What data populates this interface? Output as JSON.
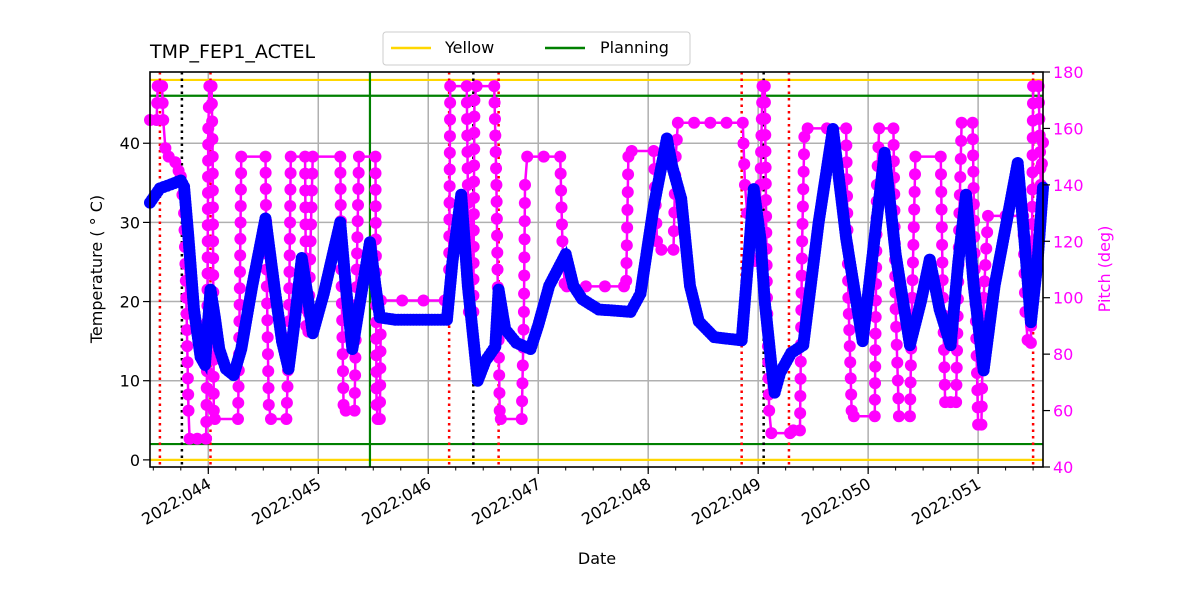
{
  "chart_data": {
    "type": "line",
    "title": "TMP_FEP1_ACTEL",
    "xlabel": "Date",
    "ylabel": "Temperature ($^\\circ$C)",
    "ylabel_display": "Temperature ( ° C)",
    "y2label": "Pitch (deg)",
    "grid": true,
    "legend": {
      "placement": "top-center",
      "entries": [
        "Yellow",
        "Planning"
      ]
    },
    "xlim": [
      43.47,
      51.59
    ],
    "ylim": [
      -0.9,
      49
    ],
    "y2lim": [
      40,
      180
    ],
    "x_ticks": [
      {
        "value": 44,
        "label": "2022:044"
      },
      {
        "value": 45,
        "label": "2022:045"
      },
      {
        "value": 46,
        "label": "2022:046"
      },
      {
        "value": 47,
        "label": "2022:047"
      },
      {
        "value": 48,
        "label": "2022:048"
      },
      {
        "value": 49,
        "label": "2022:049"
      },
      {
        "value": 50,
        "label": "2022:050"
      },
      {
        "value": 51,
        "label": "2022:051"
      }
    ],
    "x_minor_step": 0.25,
    "y_ticks": [
      0,
      10,
      20,
      30,
      40
    ],
    "y2_ticks": [
      40,
      60,
      80,
      100,
      120,
      140,
      160,
      180
    ],
    "limit_lines": [
      {
        "name": "Yellow",
        "values": [
          48,
          0
        ],
        "color": "#ffd700"
      },
      {
        "name": "Planning",
        "values": [
          46,
          2
        ],
        "color": "#008000"
      }
    ],
    "vlines": [
      {
        "x": 43.56,
        "color": "#ff0000",
        "style": "dotted"
      },
      {
        "x": 44.02,
        "color": "#ff0000",
        "style": "dotted"
      },
      {
        "x": 46.19,
        "color": "#ff0000",
        "style": "dotted"
      },
      {
        "x": 46.64,
        "color": "#ff0000",
        "style": "dotted"
      },
      {
        "x": 48.85,
        "color": "#ff0000",
        "style": "dotted"
      },
      {
        "x": 49.28,
        "color": "#ff0000",
        "style": "dotted"
      },
      {
        "x": 51.5,
        "color": "#ff0000",
        "style": "dotted"
      },
      {
        "x": 43.76,
        "color": "#000000",
        "style": "dotted"
      },
      {
        "x": 46.41,
        "color": "#000000",
        "style": "dotted"
      },
      {
        "x": 49.05,
        "color": "#000000",
        "style": "dotted"
      },
      {
        "x": 45.47,
        "color": "#008000",
        "style": "solid"
      }
    ],
    "series": [
      {
        "name": "TMP_FEP1_ACTEL",
        "axis": "left",
        "color": "#0000ff",
        "points": [
          [
            43.47,
            32.5
          ],
          [
            43.56,
            34.3
          ],
          [
            43.66,
            34.8
          ],
          [
            43.75,
            35.3
          ],
          [
            43.78,
            34.5
          ],
          [
            43.82,
            28
          ],
          [
            43.87,
            19
          ],
          [
            43.93,
            13
          ],
          [
            43.97,
            12
          ],
          [
            44.02,
            21.5
          ],
          [
            44.06,
            18
          ],
          [
            44.1,
            14
          ],
          [
            44.16,
            11.5
          ],
          [
            44.23,
            10.7
          ],
          [
            44.3,
            14
          ],
          [
            44.4,
            22
          ],
          [
            44.52,
            30.5
          ],
          [
            44.6,
            22
          ],
          [
            44.67,
            15
          ],
          [
            44.73,
            11.5
          ],
          [
            44.79,
            18
          ],
          [
            44.85,
            25.5
          ],
          [
            44.9,
            21
          ],
          [
            44.95,
            16
          ],
          [
            45.05,
            21
          ],
          [
            45.2,
            30
          ],
          [
            45.25,
            22
          ],
          [
            45.31,
            14
          ],
          [
            45.38,
            20
          ],
          [
            45.47,
            27.5
          ],
          [
            45.52,
            22
          ],
          [
            45.56,
            18
          ],
          [
            45.7,
            17.7
          ],
          [
            46.17,
            17.7
          ],
          [
            46.22,
            25
          ],
          [
            46.3,
            33.5
          ],
          [
            46.36,
            22
          ],
          [
            46.42,
            14
          ],
          [
            46.45,
            10
          ],
          [
            46.52,
            12.5
          ],
          [
            46.61,
            14.3
          ],
          [
            46.64,
            21.5
          ],
          [
            46.7,
            16.5
          ],
          [
            46.8,
            14.8
          ],
          [
            46.93,
            14
          ],
          [
            47.0,
            17
          ],
          [
            47.1,
            22
          ],
          [
            47.25,
            26
          ],
          [
            47.32,
            22
          ],
          [
            47.4,
            20.3
          ],
          [
            47.55,
            19
          ],
          [
            47.84,
            18.7
          ],
          [
            47.93,
            21
          ],
          [
            48.05,
            32
          ],
          [
            48.17,
            40.6
          ],
          [
            48.22,
            37
          ],
          [
            48.3,
            33
          ],
          [
            48.38,
            22
          ],
          [
            48.46,
            17.5
          ],
          [
            48.6,
            15.5
          ],
          [
            48.85,
            15.1
          ],
          [
            48.92,
            27
          ],
          [
            48.96,
            34.2
          ],
          [
            49.02,
            28
          ],
          [
            49.06,
            20
          ],
          [
            49.12,
            12
          ],
          [
            49.15,
            8.5
          ],
          [
            49.2,
            11
          ],
          [
            49.3,
            13.5
          ],
          [
            49.41,
            14.5
          ],
          [
            49.55,
            30
          ],
          [
            49.68,
            41.8
          ],
          [
            49.8,
            28
          ],
          [
            49.95,
            15
          ],
          [
            50.05,
            27
          ],
          [
            50.15,
            38.8
          ],
          [
            50.25,
            26
          ],
          [
            50.38,
            14.5
          ],
          [
            50.48,
            20
          ],
          [
            50.56,
            25.3
          ],
          [
            50.65,
            19
          ],
          [
            50.75,
            14.5
          ],
          [
            50.82,
            25
          ],
          [
            50.89,
            33.5
          ],
          [
            50.96,
            22
          ],
          [
            51.05,
            11.3
          ],
          [
            51.15,
            22
          ],
          [
            51.36,
            37.5
          ],
          [
            51.42,
            28
          ],
          [
            51.48,
            17.4
          ],
          [
            51.54,
            25
          ],
          [
            51.59,
            34.4
          ]
        ]
      },
      {
        "name": "Pitch",
        "axis": "right",
        "color": "#ff00ff",
        "points": [
          [
            43.47,
            163
          ],
          [
            43.53,
            163
          ],
          [
            43.54,
            175
          ],
          [
            43.58,
            175
          ],
          [
            43.59,
            163
          ],
          [
            43.61,
            153
          ],
          [
            43.64,
            150
          ],
          [
            43.7,
            148
          ],
          [
            43.73,
            145
          ],
          [
            43.75,
            143
          ],
          [
            43.78,
            130
          ],
          [
            43.8,
            100
          ],
          [
            43.82,
            60
          ],
          [
            43.83,
            50
          ],
          [
            43.9,
            50
          ],
          [
            43.98,
            50
          ],
          [
            43.99,
            80
          ],
          [
            44.0,
            160
          ],
          [
            44.01,
            175
          ],
          [
            44.03,
            175
          ],
          [
            44.04,
            150
          ],
          [
            44.05,
            60
          ],
          [
            44.06,
            57
          ],
          [
            44.27,
            57
          ],
          [
            44.28,
            80
          ],
          [
            44.3,
            150
          ],
          [
            44.52,
            150
          ],
          [
            44.53,
            110
          ],
          [
            44.55,
            62
          ],
          [
            44.57,
            57
          ],
          [
            44.71,
            57
          ],
          [
            44.73,
            80
          ],
          [
            44.75,
            150
          ],
          [
            44.88,
            150
          ],
          [
            44.89,
            90
          ],
          [
            44.91,
            88
          ],
          [
            44.93,
            120
          ],
          [
            44.95,
            150
          ],
          [
            45.2,
            150
          ],
          [
            45.21,
            110
          ],
          [
            45.23,
            62
          ],
          [
            45.25,
            60
          ],
          [
            45.33,
            60
          ],
          [
            45.35,
            110
          ],
          [
            45.37,
            150
          ],
          [
            45.52,
            150
          ],
          [
            45.53,
            62
          ],
          [
            45.54,
            57
          ],
          [
            45.56,
            57
          ],
          [
            45.57,
            99
          ],
          [
            46.15,
            99
          ],
          [
            46.19,
            110
          ],
          [
            46.2,
            175
          ],
          [
            46.35,
            175
          ],
          [
            46.36,
            140
          ],
          [
            46.37,
            95
          ],
          [
            46.41,
            95
          ],
          [
            46.42,
            170
          ],
          [
            46.44,
            175
          ],
          [
            46.6,
            175
          ],
          [
            46.62,
            140
          ],
          [
            46.63,
            110
          ],
          [
            46.65,
            60
          ],
          [
            46.66,
            57
          ],
          [
            46.85,
            57
          ],
          [
            46.87,
            95
          ],
          [
            46.88,
            140
          ],
          [
            46.9,
            150
          ],
          [
            47.2,
            150
          ],
          [
            47.22,
            120
          ],
          [
            47.24,
            105
          ],
          [
            47.26,
            104
          ],
          [
            47.78,
            104
          ],
          [
            47.8,
            106
          ],
          [
            47.82,
            150
          ],
          [
            47.85,
            152
          ],
          [
            48.05,
            152
          ],
          [
            48.08,
            120
          ],
          [
            48.12,
            117
          ],
          [
            48.23,
            117
          ],
          [
            48.25,
            150
          ],
          [
            48.27,
            162
          ],
          [
            48.86,
            162
          ],
          [
            48.88,
            140
          ],
          [
            48.9,
            130
          ],
          [
            48.95,
            120
          ],
          [
            48.97,
            113
          ],
          [
            49.0,
            113
          ],
          [
            49.02,
            140
          ],
          [
            49.04,
            175
          ],
          [
            49.06,
            175
          ],
          [
            49.08,
            100
          ],
          [
            49.1,
            60
          ],
          [
            49.12,
            52
          ],
          [
            49.29,
            52
          ],
          [
            49.32,
            53
          ],
          [
            49.38,
            53
          ],
          [
            49.4,
            120
          ],
          [
            49.42,
            157
          ],
          [
            49.45,
            160
          ],
          [
            49.8,
            160
          ],
          [
            49.82,
            100
          ],
          [
            49.85,
            60
          ],
          [
            49.87,
            58
          ],
          [
            50.06,
            58
          ],
          [
            50.08,
            140
          ],
          [
            50.1,
            160
          ],
          [
            50.23,
            160
          ],
          [
            50.25,
            96
          ],
          [
            50.28,
            58
          ],
          [
            50.38,
            58
          ],
          [
            50.4,
            100
          ],
          [
            50.43,
            150
          ],
          [
            50.66,
            150
          ],
          [
            50.68,
            100
          ],
          [
            50.7,
            63
          ],
          [
            50.75,
            63
          ],
          [
            50.8,
            63
          ],
          [
            50.83,
            130
          ],
          [
            50.85,
            162
          ],
          [
            50.95,
            162
          ],
          [
            50.97,
            110
          ],
          [
            51.0,
            55
          ],
          [
            51.03,
            55
          ],
          [
            51.05,
            100
          ],
          [
            51.09,
            129
          ],
          [
            51.41,
            129
          ],
          [
            51.43,
            95
          ],
          [
            51.45,
            85
          ],
          [
            51.48,
            84
          ],
          [
            51.49,
            120
          ],
          [
            51.5,
            175
          ],
          [
            51.55,
            175
          ],
          [
            51.57,
            140
          ],
          [
            51.59,
            155
          ]
        ]
      }
    ]
  }
}
